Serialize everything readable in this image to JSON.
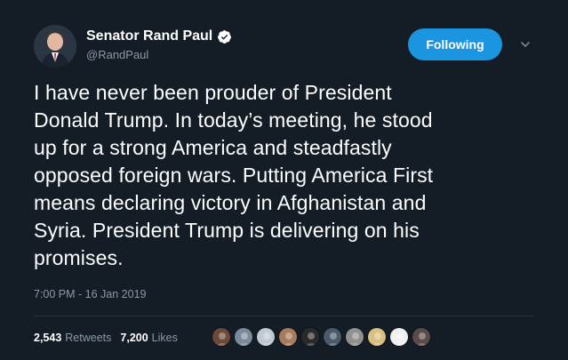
{
  "author": {
    "name": "Senator Rand Paul",
    "handle": "@RandPaul",
    "verified": true
  },
  "follow_button": {
    "label": "Following"
  },
  "tweet": {
    "text": "I have never been prouder of President\nDonald Trump. In today’s meeting, he stood\nup for a strong America and steadfastly\nopposed foreign wars. Putting America First\nmeans declaring victory in Afghanistan and\nSyria. President Trump is delivering on his\npromises.",
    "timestamp": "7:00 PM - 16 Jan 2019"
  },
  "stats": {
    "retweets_count": "2,543",
    "retweets_label": "Retweets",
    "likes_count": "7,200",
    "likes_label": "Likes"
  },
  "colors": {
    "background": "#141d26",
    "accent": "#1b95e0",
    "secondary_text": "#8899a6",
    "divider": "#253341"
  },
  "icons": {
    "verified": "verified-badge-icon",
    "menu": "chevron-down-icon"
  },
  "liker_avatars": [
    {
      "color": "#6b4a3a"
    },
    {
      "color": "#7a8a9a"
    },
    {
      "color": "#c0c8d0"
    },
    {
      "color": "#a87b5c"
    },
    {
      "color": "#2a2a2a"
    },
    {
      "color": "#4a5a6a"
    },
    {
      "color": "#909090"
    },
    {
      "color": "#d8c080"
    },
    {
      "color": "#f0f0f0"
    },
    {
      "color": "#5a4a4a"
    }
  ]
}
